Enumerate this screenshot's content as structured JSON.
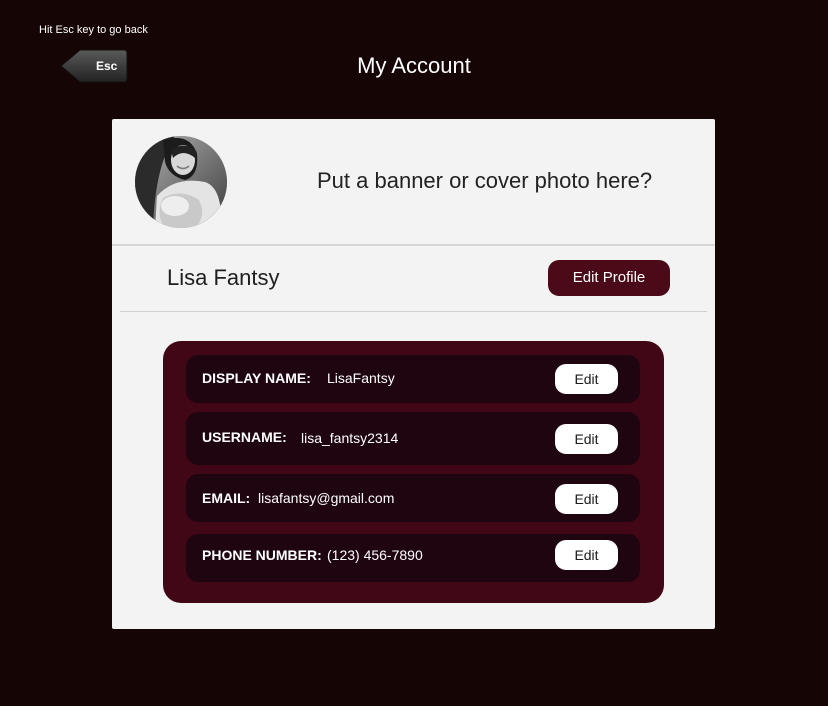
{
  "hint": "Hit Esc key to go back",
  "back_button": {
    "label": "Esc"
  },
  "page_title": "My Account",
  "banner": {
    "placeholder_text": "Put a banner or cover photo here?"
  },
  "profile": {
    "name": "Lisa Fantsy",
    "edit_button": "Edit Profile"
  },
  "fields": [
    {
      "label": "DISPLAY NAME:",
      "value": "LisaFantsy",
      "edit": "Edit"
    },
    {
      "label": "USERNAME:",
      "value": "lisa_fantsy2314",
      "edit": "Edit"
    },
    {
      "label": "EMAIL:",
      "value": "lisafantsy@gmail.com",
      "edit": "Edit"
    },
    {
      "label": "PHONE NUMBER:",
      "value": "(123) 456-7890",
      "edit": "Edit"
    }
  ],
  "colors": {
    "background": "#160505",
    "card": "#f3f3f3",
    "accent": "#4a0a17",
    "details_panel": "#410716",
    "field_row": "#1f0510"
  }
}
